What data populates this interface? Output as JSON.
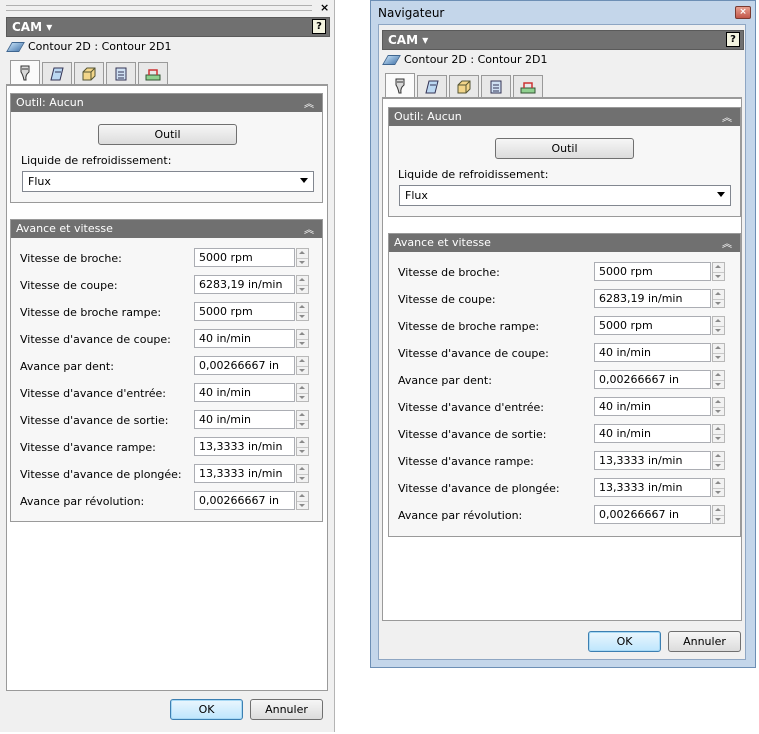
{
  "left_panel": {
    "close_glyph": "×",
    "header": {
      "title": "CAM ▾",
      "help_glyph": "?"
    },
    "breadcrumb": "Contour 2D : Contour 2D1",
    "tabs": [
      {
        "icon": "tool-icon",
        "active": true
      },
      {
        "icon": "geometry-icon",
        "active": false
      },
      {
        "icon": "heights-icon",
        "active": false
      },
      {
        "icon": "passes-icon",
        "active": false
      },
      {
        "icon": "linking-icon",
        "active": false
      }
    ],
    "tool_section": {
      "title": "Outil: Aucun",
      "tool_button": "Outil",
      "coolant_label": "Liquide de refroidissement:",
      "coolant_value": "Flux"
    },
    "feed_section": {
      "title": "Avance et vitesse",
      "rows": [
        {
          "label": "Vitesse de broche:",
          "value": "5000 rpm"
        },
        {
          "label": "Vitesse de coupe:",
          "value": "6283,19 in/min"
        },
        {
          "label": "Vitesse de broche rampe:",
          "value": "5000 rpm"
        },
        {
          "label": "Vitesse d'avance de coupe:",
          "value": "40 in/min"
        },
        {
          "label": "Avance par dent:",
          "value": "0,00266667 in"
        },
        {
          "label": "Vitesse d'avance d'entrée:",
          "value": "40 in/min"
        },
        {
          "label": "Vitesse d'avance de sortie:",
          "value": "40 in/min"
        },
        {
          "label": "Vitesse d'avance rampe:",
          "value": "13,3333 in/min"
        },
        {
          "label": "Vitesse d'avance de plongée:",
          "value": "13,3333 in/min"
        },
        {
          "label": "Avance par révolution:",
          "value": "0,00266667 in"
        }
      ]
    },
    "ok_button": "OK",
    "cancel_button": "Annuler"
  },
  "right_window": {
    "title": "Navigateur",
    "close_glyph": "×",
    "header": {
      "title": "CAM ▾",
      "help_glyph": "?"
    },
    "breadcrumb": "Contour 2D : Contour 2D1",
    "tool_section": {
      "title": "Outil: Aucun",
      "tool_button": "Outil",
      "coolant_label": "Liquide de refroidissement:",
      "coolant_value": "Flux"
    },
    "feed_section": {
      "title": "Avance et vitesse",
      "rows": [
        {
          "label": "Vitesse de broche:",
          "value": "5000 rpm"
        },
        {
          "label": "Vitesse de coupe:",
          "value": "6283,19 in/min"
        },
        {
          "label": "Vitesse de broche rampe:",
          "value": "5000 rpm"
        },
        {
          "label": "Vitesse d'avance de coupe:",
          "value": "40 in/min"
        },
        {
          "label": "Avance par dent:",
          "value": "0,00266667 in"
        },
        {
          "label": "Vitesse d'avance d'entrée:",
          "value": "40 in/min"
        },
        {
          "label": "Vitesse d'avance de sortie:",
          "value": "40 in/min"
        },
        {
          "label": "Vitesse d'avance rampe:",
          "value": "13,3333 in/min"
        },
        {
          "label": "Vitesse d'avance de plongée:",
          "value": "13,3333 in/min"
        },
        {
          "label": "Avance par révolution:",
          "value": "0,00266667 in"
        }
      ]
    },
    "ok_button": "OK",
    "cancel_button": "Annuler"
  },
  "colors": {
    "header_bg": "#707070",
    "panel_bg": "#f0f0f0",
    "window_frame": "#c4d6ea",
    "ok_focus": "#3c7fb1"
  }
}
